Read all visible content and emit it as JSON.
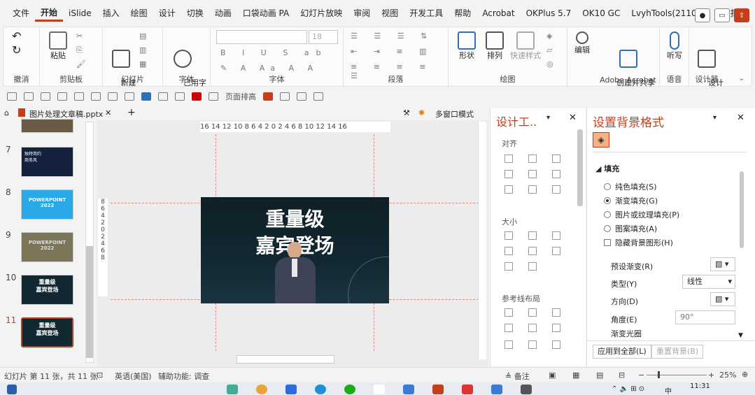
{
  "menu": [
    "文件",
    "开始",
    "iSlide",
    "插入",
    "绘图",
    "设计",
    "切换",
    "动画",
    "口袋动画 PA",
    "幻灯片放映",
    "审阅",
    "视图",
    "开发工具",
    "帮助",
    "Acrobat",
    "OKPlus 5.7",
    "OK10 GC",
    "LvyhTools(211021)",
    "简报"
  ],
  "ribbon": {
    "groups": [
      "撤消",
      "剪贴板",
      "幻灯片",
      "字体",
      "段落",
      "绘图",
      "Adobe Acrobat",
      "语音",
      "设计器"
    ],
    "paste": "粘贴",
    "new_slide": "新建\n幻灯片",
    "used_font": "已用字\n体",
    "font_size": "18",
    "shape": "形状",
    "arrange": "排列",
    "quick_style": "快速样式",
    "edit": "编辑",
    "create_share": "创建并共享\nAdobe PDF",
    "listen": "听写",
    "design_inspire": "设计\n灵感"
  },
  "qtb": {
    "page_layout": "页面排高"
  },
  "tabs": {
    "file": "图片处理文章稿.pptx",
    "multiwin": "多窗口模式"
  },
  "ruler": "16 14 12 10 8 6 4 2 0 2 4 6 8 10 12 14 16",
  "vruler": [
    "8",
    "6",
    "4",
    "2",
    "0",
    "2",
    "4",
    "6",
    "8"
  ],
  "thumbs": [
    {
      "num": "7",
      "text": "独特简约\n商务风"
    },
    {
      "num": "8",
      "text": "POWERPOINT\n2022"
    },
    {
      "num": "9",
      "text": "POWERPOINT\n2022"
    },
    {
      "num": "10",
      "text": "重量级\n嘉宾登场"
    },
    {
      "num": "11",
      "text": "重量级\n嘉宾登场"
    }
  ],
  "slide": {
    "title1": "重量级",
    "title2": "嘉宾登场"
  },
  "design_pane": {
    "title": "设计工..",
    "align": "对齐",
    "size": "大小",
    "guides": "参考线布局"
  },
  "format_pane": {
    "title": "设置背景格式",
    "fill": "填充",
    "options": [
      "纯色填充(S)",
      "渐变填充(G)",
      "图片或纹理填充(P)",
      "图案填充(A)"
    ],
    "hide_bg": "隐藏背景图形(H)",
    "preset": "预设渐变(R)",
    "type": "类型(Y)",
    "type_val": "线性",
    "direction": "方向(D)",
    "angle": "角度(E)",
    "angle_val": "90°",
    "stops": "渐变光圈",
    "apply_all": "应用到全部(L)",
    "reset": "重置背景(B)"
  },
  "status": {
    "slide_info": "幻灯片 第 11 张，共 11 张",
    "lang": "英语(美国)",
    "access": "辅助功能: 调查",
    "notes": "备注",
    "zoom": "25%"
  },
  "taskbar": {
    "time": "11:31",
    "ime": "中"
  },
  "colors": {
    "accent": "#c43e1c",
    "slide_bg": "#122831"
  }
}
